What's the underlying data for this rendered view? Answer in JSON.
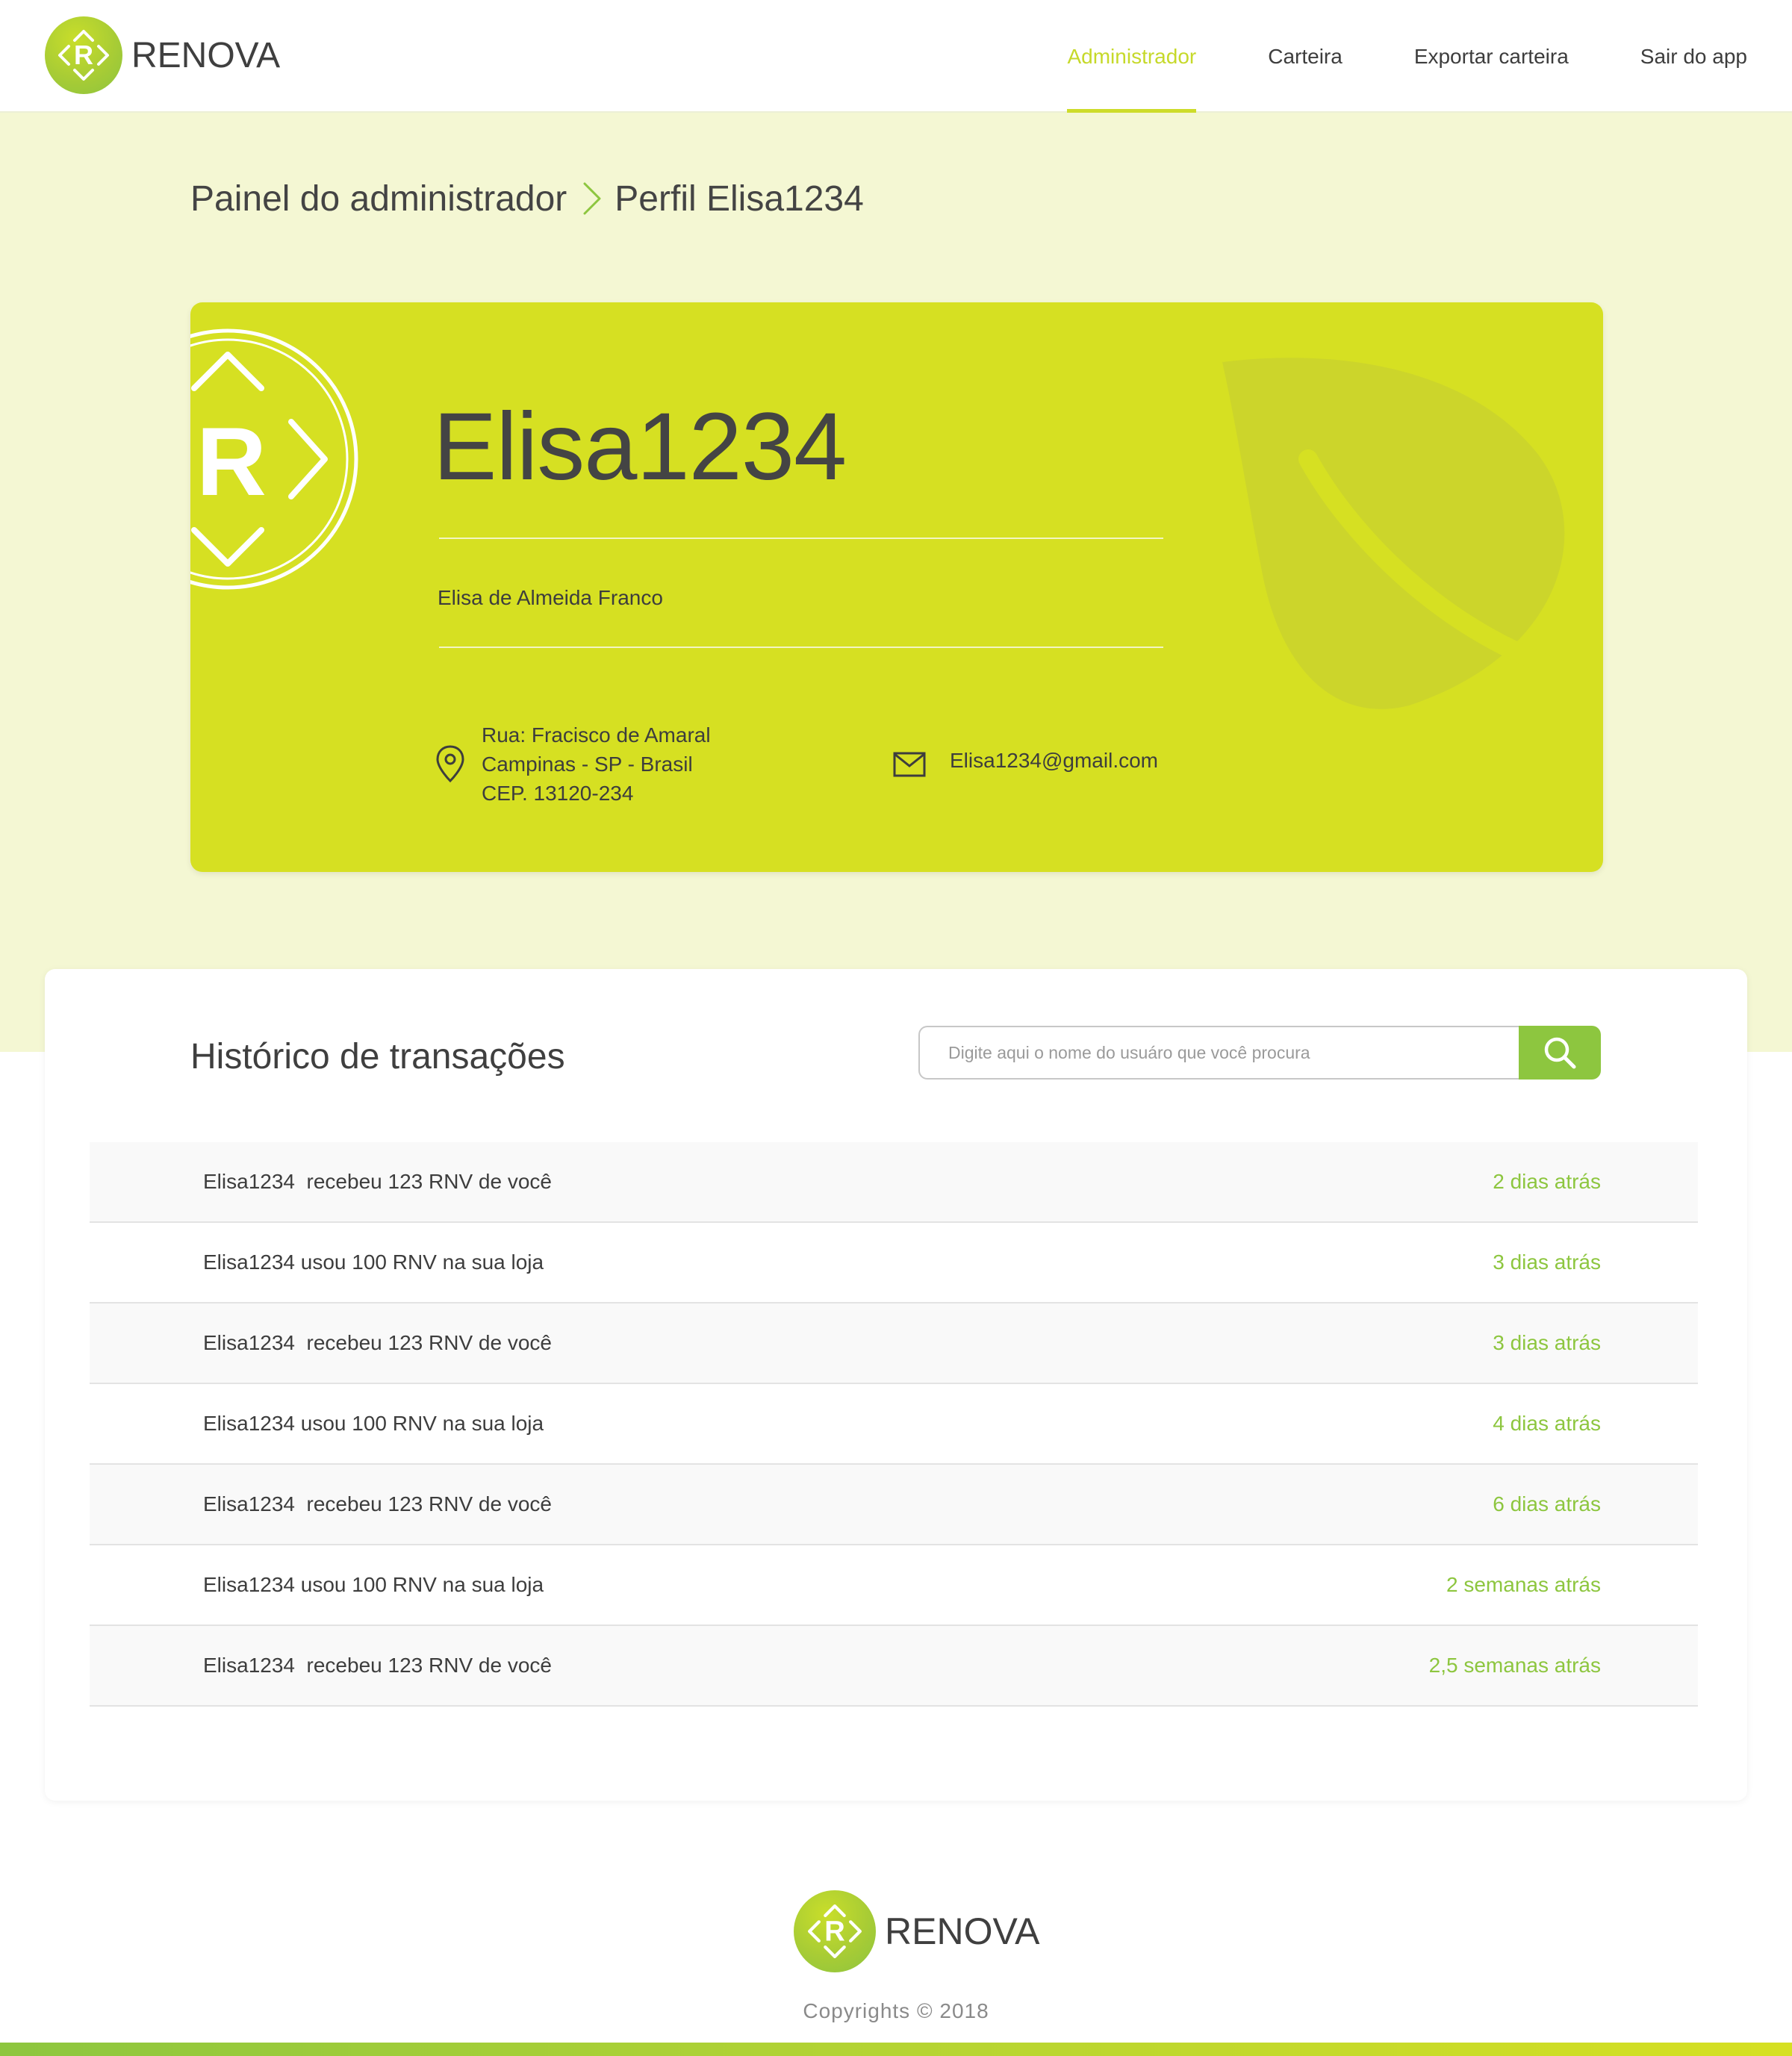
{
  "brand": {
    "name": "RENOVA",
    "logo_letter": "R"
  },
  "nav": {
    "items": [
      {
        "label": "Administrador",
        "active": true
      },
      {
        "label": "Carteira",
        "active": false
      },
      {
        "label": "Exportar carteira",
        "active": false
      },
      {
        "label": "Sair do app",
        "active": false
      }
    ]
  },
  "breadcrumb": {
    "parent": "Painel do administrador",
    "current": "Perfil Elisa1234"
  },
  "profile": {
    "username": "Elisa1234",
    "full_name": "Elisa de Almeida Franco",
    "address_lines": [
      "Rua: Fracisco de Amaral",
      "Campinas - SP - Brasil",
      "CEP. 13120-234"
    ],
    "email": "Elisa1234@gmail.com"
  },
  "history": {
    "title": "Histórico de transações",
    "search_placeholder": "Digite aqui o nome do usuáro que você procura",
    "rows": [
      {
        "text": "Elisa1234  recebeu 123 RNV de você",
        "time": "2 dias atrás"
      },
      {
        "text": "Elisa1234 usou 100 RNV na sua loja",
        "time": "3 dias atrás"
      },
      {
        "text": "Elisa1234  recebeu 123 RNV de você",
        "time": "3 dias atrás"
      },
      {
        "text": "Elisa1234 usou 100 RNV na sua loja",
        "time": "4 dias atrás"
      },
      {
        "text": "Elisa1234  recebeu 123 RNV de você",
        "time": "6 dias atrás"
      },
      {
        "text": "Elisa1234 usou 100 RNV na sua loja",
        "time": "2 semanas atrás"
      },
      {
        "text": "Elisa1234  recebeu 123 RNV de você",
        "time": "2,5 semanas atrás"
      }
    ]
  },
  "footer": {
    "brand_name": "RENOVA",
    "copyright": "Copyrights © 2018"
  },
  "colors": {
    "accent": "#d6e022",
    "accent_green": "#8dc63f",
    "band_bg": "#f4f7d3",
    "text": "#3d3d3d"
  },
  "icons": {
    "logo": "renova-logo-icon",
    "breadcrumb_separator": "chevron-right-icon",
    "address": "map-pin-icon",
    "email": "mail-icon",
    "search": "search-icon",
    "card_decoration": "leaf-icon"
  }
}
